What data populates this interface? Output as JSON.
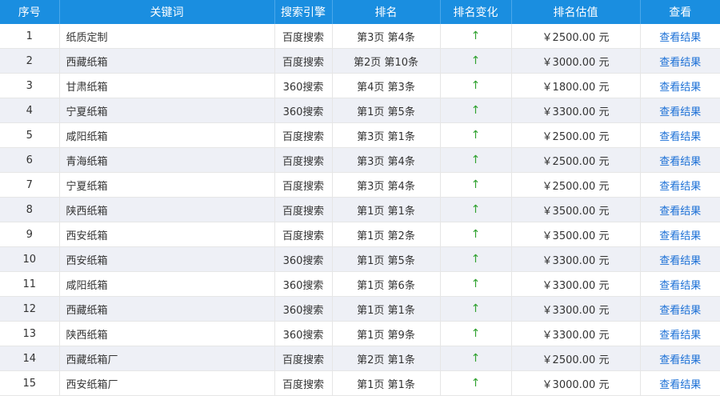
{
  "headers": [
    "序号",
    "关键词",
    "搜索引擎",
    "排名",
    "排名变化",
    "排名估值",
    "查看"
  ],
  "colors": {
    "header_bg": "#1a8ee0",
    "alt_row_bg": "#eef0f6",
    "arrow": "#2ea12e",
    "link": "#1a6fd6"
  },
  "change_icon": "arrow-up-icon",
  "arrow_glyph": "↑",
  "view_label": "查看结果",
  "rows": [
    {
      "no": "1",
      "keyword": "纸质定制",
      "engine": "百度搜索",
      "rank": "第3页 第4条",
      "value": "￥2500.00 元"
    },
    {
      "no": "2",
      "keyword": "西藏纸箱",
      "engine": "百度搜索",
      "rank": "第2页 第10条",
      "value": "￥3000.00 元"
    },
    {
      "no": "3",
      "keyword": "甘肃纸箱",
      "engine": "360搜索",
      "rank": "第4页 第3条",
      "value": "￥1800.00 元"
    },
    {
      "no": "4",
      "keyword": "宁夏纸箱",
      "engine": "360搜索",
      "rank": "第1页 第5条",
      "value": "￥3300.00 元"
    },
    {
      "no": "5",
      "keyword": "咸阳纸箱",
      "engine": "百度搜索",
      "rank": "第3页 第1条",
      "value": "￥2500.00 元"
    },
    {
      "no": "6",
      "keyword": "青海纸箱",
      "engine": "百度搜索",
      "rank": "第3页 第4条",
      "value": "￥2500.00 元"
    },
    {
      "no": "7",
      "keyword": "宁夏纸箱",
      "engine": "百度搜索",
      "rank": "第3页 第4条",
      "value": "￥2500.00 元"
    },
    {
      "no": "8",
      "keyword": "陕西纸箱",
      "engine": "百度搜索",
      "rank": "第1页 第1条",
      "value": "￥3500.00 元"
    },
    {
      "no": "9",
      "keyword": "西安纸箱",
      "engine": "百度搜索",
      "rank": "第1页 第2条",
      "value": "￥3500.00 元"
    },
    {
      "no": "10",
      "keyword": "西安纸箱",
      "engine": "360搜索",
      "rank": "第1页 第5条",
      "value": "￥3300.00 元"
    },
    {
      "no": "11",
      "keyword": "咸阳纸箱",
      "engine": "360搜索",
      "rank": "第1页 第6条",
      "value": "￥3300.00 元"
    },
    {
      "no": "12",
      "keyword": "西藏纸箱",
      "engine": "360搜索",
      "rank": "第1页 第1条",
      "value": "￥3300.00 元"
    },
    {
      "no": "13",
      "keyword": "陕西纸箱",
      "engine": "360搜索",
      "rank": "第1页 第9条",
      "value": "￥3300.00 元"
    },
    {
      "no": "14",
      "keyword": "西藏纸箱厂",
      "engine": "百度搜索",
      "rank": "第2页 第1条",
      "value": "￥2500.00 元"
    },
    {
      "no": "15",
      "keyword": "西安纸箱厂",
      "engine": "百度搜索",
      "rank": "第1页 第1条",
      "value": "￥3000.00 元"
    }
  ]
}
